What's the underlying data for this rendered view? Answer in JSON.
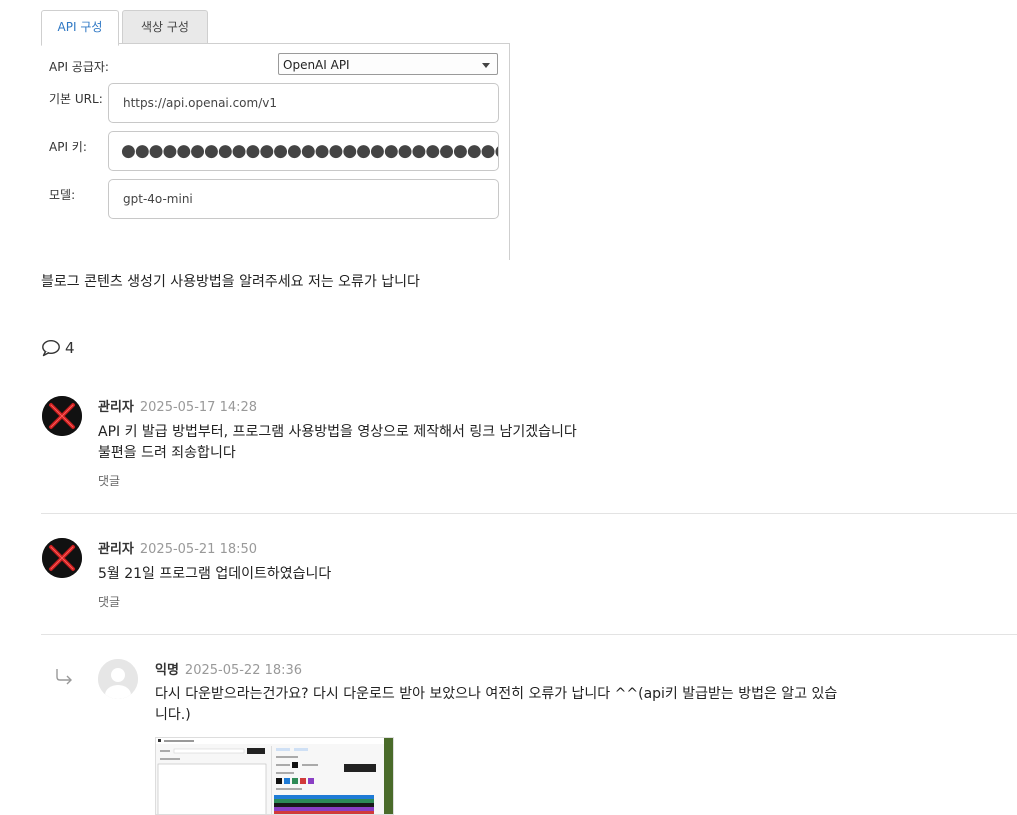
{
  "settings": {
    "tabs": [
      "API 구성",
      "색상 구성"
    ],
    "provider_label": "API 공급자:",
    "provider_value": "OpenAI API",
    "base_url_label": "기본 URL:",
    "base_url_value": "https://api.openai.com/v1",
    "api_key_label": "API 키:",
    "api_key_value": "●●●●●●●●●●●●●●●●●●●●●●●●●●●●●●●●●",
    "model_label": "모델:",
    "model_value": "gpt-4o-mini"
  },
  "post": {
    "text": "블로그 콘텐츠 생성기 사용방법을 알려주세요 저는 오류가 납니다",
    "comment_count": "4"
  },
  "comments": [
    {
      "author": "관리자",
      "date": "2025-05-17 14:28",
      "lines": [
        "API 키 발급 방법부터, 프로그램 사용방법을 영상으로 제작해서 링크 남기겠습니다",
        "불편을 드려 죄송합니다"
      ],
      "reply_label": "댓글"
    },
    {
      "author": "관리자",
      "date": "2025-05-21 18:50",
      "lines": [
        "5월 21일 프로그램 업데이트하였습니다"
      ],
      "reply_label": "댓글"
    },
    {
      "author": "익명",
      "date": "2025-05-22 18:36",
      "lines": [
        "다시 다운받으라는건가요? 다시 다운로드 받아 보았으나 여전히 오류가 납니다 ^^(api키 발급받는 방법은 알고 있습",
        "니다.)"
      ]
    }
  ],
  "colors": {
    "tab_active": "#2f78c4",
    "admin_avatar_bg": "#111111",
    "admin_avatar_x": "#c81e1e"
  }
}
